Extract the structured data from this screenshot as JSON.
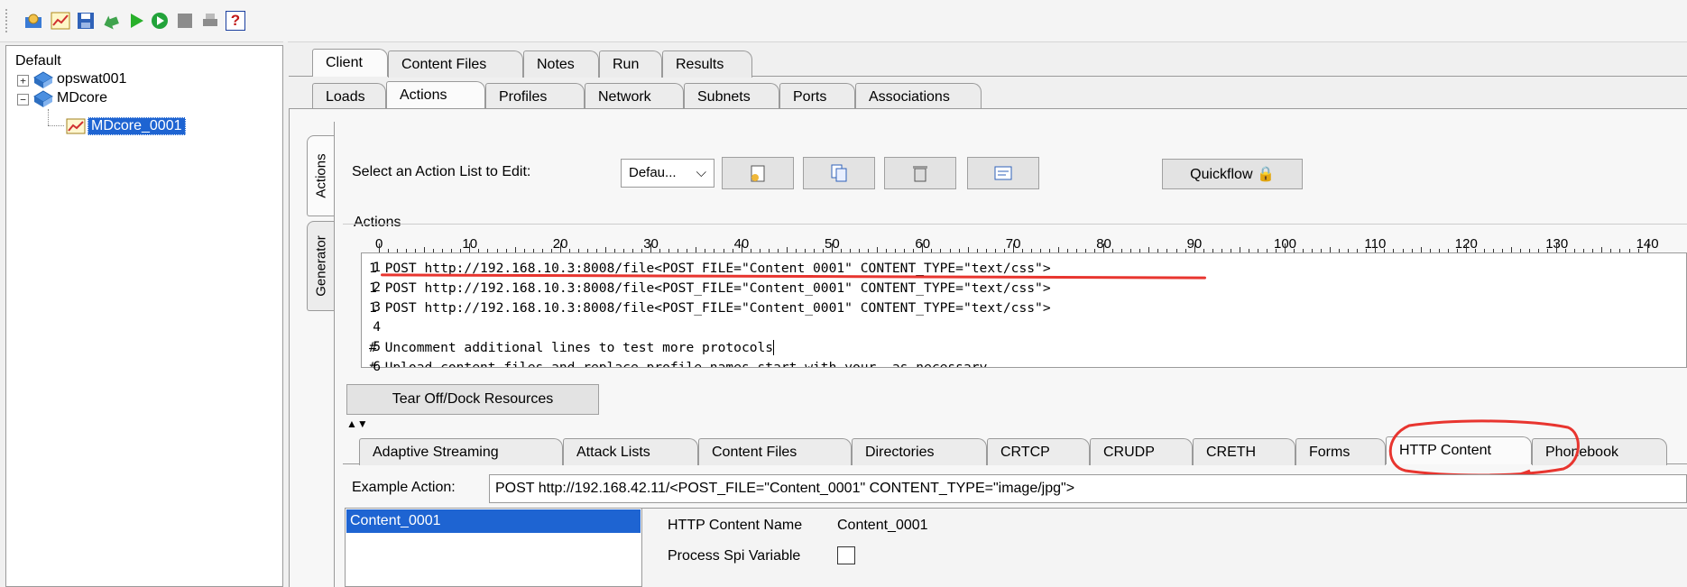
{
  "toolbar": {
    "icons": [
      "open-icon",
      "chart-icon",
      "save-icon",
      "arrow-right-icon",
      "play-icon",
      "go-circle-icon",
      "stop-icon",
      "print-icon",
      "help-icon"
    ],
    "help_label": "?"
  },
  "tree": {
    "root": "Default",
    "nodes": [
      {
        "label": "opswat001",
        "expander": "+"
      },
      {
        "label": "MDcore",
        "expander": "−"
      },
      {
        "label": "MDcore_0001",
        "selected": true
      }
    ]
  },
  "tabs_row1": [
    "Client",
    "Content Files",
    "Notes",
    "Run",
    "Results"
  ],
  "tabs_row1_active": "Client",
  "tabs_row2": [
    "Loads",
    "Actions",
    "Profiles",
    "Network",
    "Subnets",
    "Ports",
    "Associations"
  ],
  "tabs_row2_active": "Actions",
  "side_tabs": [
    "Actions",
    "Generator"
  ],
  "action_list": {
    "label": "Select an Action List to Edit:",
    "select_value": "Defau...",
    "quickflow_label": "Quickflow 🔒"
  },
  "actions": {
    "section_label": "Actions",
    "ruler": [
      "0",
      "10",
      "20",
      "30",
      "40",
      "50",
      "60",
      "70",
      "80",
      "90",
      "100",
      "110",
      "120",
      "130",
      "140"
    ],
    "lines": [
      {
        "num": "1",
        "text": "1 POST http://192.168.10.3:8008/file<POST_FILE=\"Content_0001\" CONTENT_TYPE=\"text/css\">"
      },
      {
        "num": "2",
        "text": "1 POST http://192.168.10.3:8008/file<POST_FILE=\"Content_0001\" CONTENT_TYPE=\"text/css\">"
      },
      {
        "num": "3",
        "text": "1 POST http://192.168.10.3:8008/file<POST_FILE=\"Content_0001\" CONTENT_TYPE=\"text/css\">"
      },
      {
        "num": "4",
        "text": ""
      },
      {
        "num": "5",
        "text": "# Uncomment additional lines to test more protocols"
      },
      {
        "num": "6",
        "text": "# Upload content files and replace profile names start with your  as necessary"
      }
    ],
    "tear_off_label": "Tear Off/Dock Resources"
  },
  "resource_tabs": [
    "Adaptive Streaming",
    "Attack Lists",
    "Content Files",
    "Directories",
    "CRTCP",
    "CRUDP",
    "CRETH",
    "Forms",
    "HTTP Content",
    "Phonebook"
  ],
  "resource_tabs_active": "HTTP Content",
  "example_action": {
    "label": "Example Action:",
    "value": "POST http://192.168.42.11/<POST_FILE=\"Content_0001\" CONTENT_TYPE=\"image/jpg\">"
  },
  "content_list": [
    "Content_0001"
  ],
  "details": {
    "name_label": "HTTP Content Name",
    "name_value": "Content_0001",
    "spi_label": "Process Spi Variable"
  },
  "colors": {
    "annotation_red": "#e8352f",
    "selection_blue": "#1e64d2"
  }
}
